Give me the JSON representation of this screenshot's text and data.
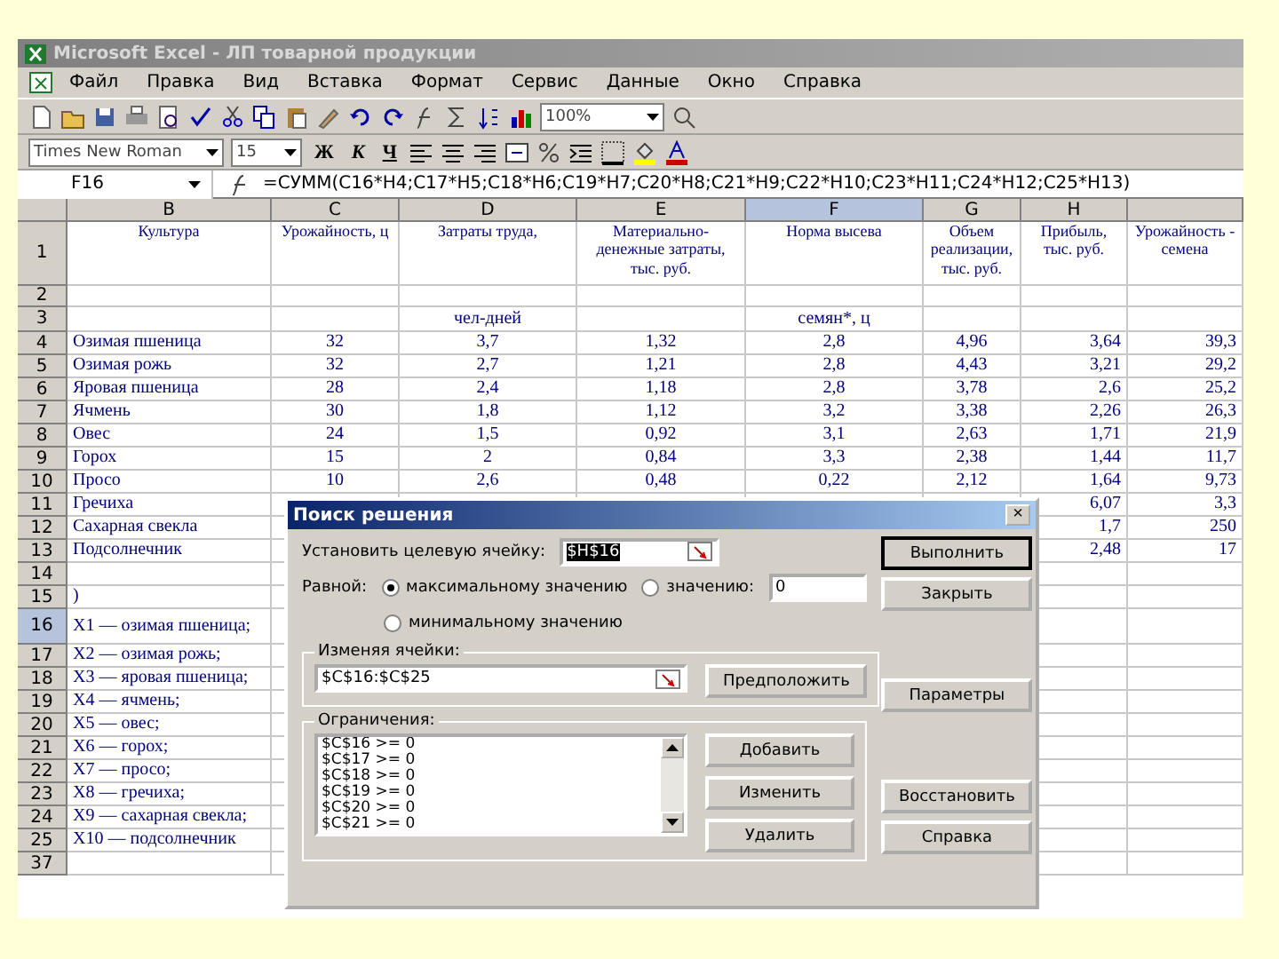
{
  "window": {
    "title": "Microsoft Excel - ЛП товарной продукции"
  },
  "menu": [
    "Файл",
    "Правка",
    "Вид",
    "Вставка",
    "Формат",
    "Сервис",
    "Данные",
    "Окно",
    "Справка"
  ],
  "format_toolbar": {
    "font": "Times New Roman",
    "size": "15",
    "zoom": "100%",
    "letters": [
      "Ж",
      "К",
      "Ч"
    ]
  },
  "formula_bar": {
    "cell": "F16",
    "formula": "=СУММ(C16*H4;C17*H5;C18*H6;C19*H7;C20*H8;C21*H9;C22*H10;C23*H11;C24*H12;C25*H13)"
  },
  "sheet": {
    "columns": [
      {
        "label": "B",
        "selected": false
      },
      {
        "label": "C",
        "selected": false
      },
      {
        "label": "D",
        "selected": false
      },
      {
        "label": "E",
        "selected": false
      },
      {
        "label": "F",
        "selected": true
      },
      {
        "label": "G",
        "selected": false
      },
      {
        "label": "H",
        "selected": false
      }
    ],
    "rows": [
      {
        "label": "1",
        "kind": "head",
        "selected": false,
        "cells": {
          "b": "Культура",
          "c": "Урожайность, ц",
          "d": "Затраты труда,",
          "e": "Материально-денежные затраты, тыс. руб.",
          "f": "Норма высева",
          "g": "Объем реализации, тыс. руб.",
          "h": "Прибыль, тыс. руб.",
          "column_9": "Урожайность - семена"
        }
      },
      {
        "label": "2",
        "kind": "gap",
        "selected": false,
        "cells": {}
      },
      {
        "label": "3",
        "kind": "units",
        "selected": false,
        "cells": {
          "d": "чел-дней",
          "f": "семян*, ц"
        }
      },
      {
        "label": "4",
        "kind": "data",
        "selected": false,
        "cells": {
          "b": "Озимая пшеница",
          "c": "32",
          "d": "3,7",
          "e": "1,32",
          "f": "2,8",
          "g": "4,96",
          "h": "3,64",
          "column_9": "39,3"
        }
      },
      {
        "label": "5",
        "kind": "data",
        "selected": false,
        "cells": {
          "b": "Озимая рожь",
          "c": "32",
          "d": "2,7",
          "e": "1,21",
          "f": "2,8",
          "g": "4,43",
          "h": "3,21",
          "column_9": "29,2"
        }
      },
      {
        "label": "6",
        "kind": "data",
        "selected": false,
        "cells": {
          "b": "Яровая пшеница",
          "c": "28",
          "d": "2,4",
          "e": "1,18",
          "f": "2,8",
          "g": "3,78",
          "h": "2,6",
          "column_9": "25,2"
        }
      },
      {
        "label": "7",
        "kind": "data",
        "selected": false,
        "cells": {
          "b": "Ячмень",
          "c": "30",
          "d": "1,8",
          "e": "1,12",
          "f": "3,2",
          "g": "3,38",
          "h": "2,26",
          "column_9": "26,3"
        }
      },
      {
        "label": "8",
        "kind": "data",
        "selected": false,
        "cells": {
          "b": "Овес",
          "c": "24",
          "d": "1,5",
          "e": "0,92",
          "f": "3,1",
          "g": "2,63",
          "h": "1,71",
          "column_9": "21,9"
        }
      },
      {
        "label": "9",
        "kind": "data",
        "selected": false,
        "cells": {
          "b": "Горох",
          "c": "15",
          "d": "2",
          "e": "0,84",
          "f": "3,3",
          "g": "2,38",
          "h": "1,44",
          "column_9": "11,7"
        }
      },
      {
        "label": "10",
        "kind": "data",
        "selected": false,
        "cells": {
          "b": "Просо",
          "c": "10",
          "d": "2,6",
          "e": "0,48",
          "f": "0,22",
          "g": "2,12",
          "h": "1,64",
          "column_9": "9,73"
        }
      },
      {
        "label": "11",
        "kind": "data",
        "selected": false,
        "cells": {
          "b": "Гречиха",
          "h": "6,07",
          "column_9": "3,3"
        }
      },
      {
        "label": "12",
        "kind": "data",
        "selected": false,
        "cells": {
          "b": "Сахарная свекла",
          "h": "1,7",
          "column_9": "250"
        }
      },
      {
        "label": "13",
        "kind": "data",
        "selected": false,
        "cells": {
          "b": "Подсолнечник",
          "h": "2,48",
          "column_9": "17"
        }
      },
      {
        "label": "14",
        "kind": "data",
        "selected": false,
        "cells": {}
      },
      {
        "label": "15",
        "kind": "data",
        "selected": false,
        "cells": {
          "b": ")"
        }
      },
      {
        "label": "16",
        "kind": "wide",
        "selected": true,
        "cells": {
          "b": "X1 — озимая пшеница;"
        }
      },
      {
        "label": "17",
        "kind": "data",
        "selected": false,
        "cells": {
          "b": "X2 — озимая рожь;"
        }
      },
      {
        "label": "18",
        "kind": "data",
        "selected": false,
        "cells": {
          "b": "X3 — яровая пшеница;"
        }
      },
      {
        "label": "19",
        "kind": "data",
        "selected": false,
        "cells": {
          "b": "X4 — ячмень;"
        }
      },
      {
        "label": "20",
        "kind": "data",
        "selected": false,
        "cells": {
          "b": "X5 — овес;"
        }
      },
      {
        "label": "21",
        "kind": "data",
        "selected": false,
        "cells": {
          "b": "X6 — горох;"
        }
      },
      {
        "label": "22",
        "kind": "data",
        "selected": false,
        "cells": {
          "b": "X7 — просо;"
        }
      },
      {
        "label": "23",
        "kind": "data",
        "selected": false,
        "cells": {
          "b": "X8 — гречиха;"
        }
      },
      {
        "label": "24",
        "kind": "data",
        "selected": false,
        "cells": {
          "b": "X9 — сахарная свекла;"
        }
      },
      {
        "label": "25",
        "kind": "data",
        "selected": false,
        "cells": {
          "b": "X10 — подсолнечник"
        }
      },
      {
        "label": "37",
        "kind": "data",
        "selected": false,
        "cells": {}
      }
    ]
  },
  "dialog": {
    "title": "Поиск решения",
    "close": "×",
    "target_label": "Установить целевую ячейку:",
    "target": "$H$16",
    "equal_label": "Равной:",
    "goal_options": [
      {
        "label": "максимальному значению",
        "selected": true
      },
      {
        "label": "значению:",
        "selected": false,
        "value": "0"
      },
      {
        "label": "минимальному значению",
        "selected": false
      }
    ],
    "changing_label": "Изменяя ячейки:",
    "changing": "$C$16:$C$25",
    "guess_button": "Предположить",
    "constraints_label": "Ограничения:",
    "constraints": [
      "$C$16 >= 0",
      "$C$17 >= 0",
      "$C$18 >= 0",
      "$C$19 >= 0",
      "$C$20 >= 0",
      "$C$21 >= 0"
    ],
    "constraint_buttons": [
      "Добавить",
      "Изменить",
      "Удалить"
    ],
    "side_buttons": [
      {
        "label": "Выполнить",
        "kind": "default"
      },
      {
        "label": "Закрыть",
        "kind": "normal"
      },
      {
        "label": "Параметры",
        "kind": "spaced"
      },
      {
        "label": "Восстановить",
        "kind": "spaced"
      },
      {
        "label": "Справка",
        "kind": "normal"
      }
    ]
  }
}
